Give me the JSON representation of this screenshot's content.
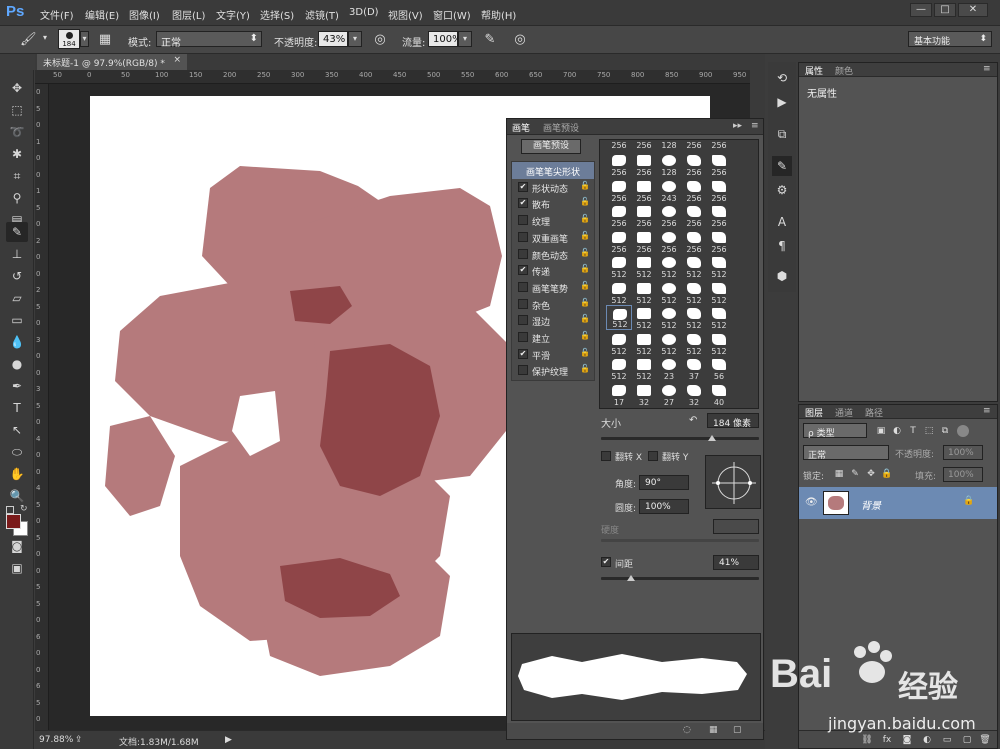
{
  "app": {
    "logo": "Ps"
  },
  "menu": [
    "文件(F)",
    "编辑(E)",
    "图像(I)",
    "图层(L)",
    "文字(Y)",
    "选择(S)",
    "滤镜(T)",
    "3D(D)",
    "视图(V)",
    "窗口(W)",
    "帮助(H)"
  ],
  "window_controls": {
    "minimize": "—",
    "maximize": "□",
    "close": "✕"
  },
  "options": {
    "brush_size": "184",
    "mode_label": "模式:",
    "mode_value": "正常",
    "opacity_label": "不透明度:",
    "opacity_value": "43%",
    "flow_label": "流量:",
    "flow_value": "100%",
    "workspace": "基本功能"
  },
  "document": {
    "tab_title": "未标题-1 @ 97.9%(RGB/8) *",
    "tab_close": "×",
    "ruler_top": [
      "50",
      "0",
      "50",
      "100",
      "150",
      "200",
      "250",
      "300",
      "350",
      "400",
      "450",
      "500",
      "550",
      "600",
      "650",
      "700",
      "750",
      "800",
      "850",
      "900",
      "950",
      "1000"
    ],
    "ruler_left": [
      "0",
      "5",
      "0",
      "1",
      "0",
      "0",
      "1",
      "5",
      "0",
      "2",
      "0",
      "0",
      "2",
      "5",
      "0",
      "3",
      "0",
      "0",
      "3",
      "5",
      "0",
      "4",
      "0",
      "0",
      "4",
      "5",
      "0",
      "5",
      "0",
      "0",
      "5",
      "5",
      "0",
      "6",
      "0",
      "0",
      "6",
      "5",
      "0"
    ]
  },
  "status": {
    "zoom": "97.88%",
    "doc_info": "文档:1.83M/1.68M"
  },
  "brush_panel": {
    "tabs": [
      "画笔",
      "画笔预设"
    ],
    "presets_button": "画笔预设",
    "items": [
      {
        "label": "画笔笔尖形状",
        "header": true
      },
      {
        "label": "形状动态",
        "checked": true
      },
      {
        "label": "散布",
        "checked": true
      },
      {
        "label": "纹理",
        "checked": false
      },
      {
        "label": "双重画笔",
        "checked": false
      },
      {
        "label": "颜色动态",
        "checked": false
      },
      {
        "label": "传递",
        "checked": true
      },
      {
        "label": "画笔笔势",
        "checked": false
      },
      {
        "label": "杂色",
        "checked": false
      },
      {
        "label": "湿边",
        "checked": false
      },
      {
        "label": "建立",
        "checked": false
      },
      {
        "label": "平滑",
        "checked": true
      },
      {
        "label": "保护纹理",
        "checked": false
      }
    ],
    "tip_rows": [
      [
        "256",
        "256",
        "128",
        "256",
        "256"
      ],
      [
        "256",
        "256",
        "243",
        "256",
        "256"
      ],
      [
        "256",
        "256",
        "256",
        "256",
        "256"
      ],
      [
        "256",
        "256",
        "256",
        "256",
        "256"
      ],
      [
        "512",
        "512",
        "512",
        "512",
        "512"
      ],
      [
        "512",
        "512",
        "512",
        "512",
        "512"
      ],
      [
        "512",
        "512",
        "512",
        "512",
        "512"
      ],
      [
        "512",
        "512",
        "512",
        "512",
        "512"
      ],
      [
        "512",
        "512",
        "23",
        "37",
        "56"
      ],
      [
        "17",
        "32",
        "27",
        "32",
        "40"
      ]
    ],
    "top_row_nums": [
      "256",
      "256",
      "128",
      "256",
      "256"
    ],
    "size_label": "大小",
    "size_value": "184 像素",
    "flip_x": "翻转 X",
    "flip_y": "翻转 Y",
    "angle_label": "角度:",
    "angle_value": "90°",
    "roundness_label": "圆度:",
    "roundness_value": "100%",
    "hardness_label": "硬度",
    "spacing_label": "间距",
    "spacing_value": "41%",
    "spacing_checked": true
  },
  "properties": {
    "tabs": [
      "属性",
      "颜色"
    ],
    "content": "无属性"
  },
  "layers": {
    "tabs": [
      "图层",
      "通道",
      "路径"
    ],
    "filter_type": "ρ 类型",
    "blend_mode": "正常",
    "opacity_label": "不透明度:",
    "opacity_value": "100%",
    "lock_label": "锁定:",
    "fill_label": "填充:",
    "fill_value": "100%",
    "layer_name": "背景"
  },
  "watermark": {
    "brand": "Bai",
    "brand2": "经验",
    "url": "jingyan.baidu.com"
  },
  "colors": {
    "foreground": "#7a1a1a",
    "brush_light": "#b57a7c",
    "brush_dark": "#8f4548",
    "accent": "#6c8ab3"
  }
}
